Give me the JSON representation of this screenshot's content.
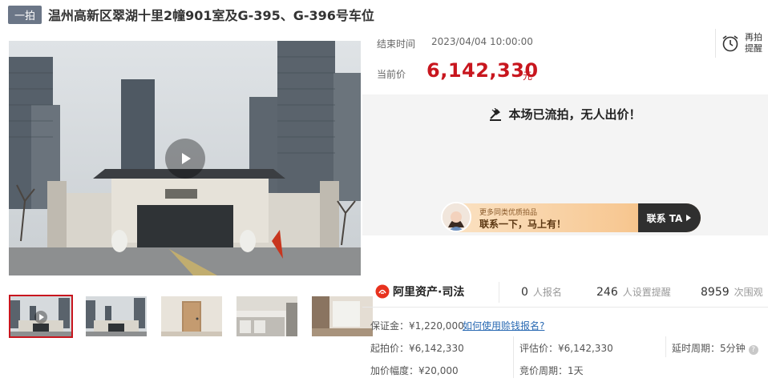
{
  "header": {
    "tag": "一拍",
    "title": "温州高新区翠湖十里2幢901室及G-395、G-396号车位"
  },
  "auction": {
    "end_time_label": "结束时间",
    "end_time": "2023/04/04 10:00:00",
    "price_label": "当前价",
    "price": "6,142,330",
    "price_unit": "元",
    "remind_label": "再拍提醒",
    "status_text": "本场已流拍，无人出价！"
  },
  "banner": {
    "small": "更多同类优质拍品",
    "main": "联系一下，马上有！",
    "button": "联系 TA"
  },
  "stats": {
    "brand": "阿里资产·司法",
    "signups_value": "0",
    "signups_label": "人报名",
    "reminders_value": "246",
    "reminders_label": "人设置提醒",
    "views_value": "8959",
    "views_label": "次围观"
  },
  "details": {
    "deposit": "保证金：¥1,220,000",
    "deposit_link": "如何使用赊钱报名?",
    "start_price": "起拍价：¥6,142,330",
    "appraisal": "评估价：¥6,142,330",
    "delay": "延时周期：5分钟",
    "increment": "加价幅度：¥20,000",
    "cycle": "竞价周期：1天"
  },
  "colors": {
    "accent": "#c8161e",
    "tag_bg": "#6b7687",
    "link": "#2a6ab3"
  },
  "icons": [
    "play-icon",
    "alarm-clock-icon",
    "gavel-icon",
    "arrow-right-icon",
    "ali-logo-icon",
    "help-icon"
  ]
}
